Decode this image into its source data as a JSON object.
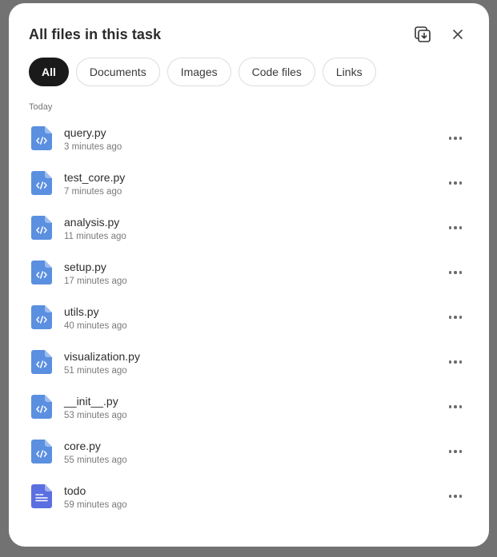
{
  "modal": {
    "title": "All files in this task"
  },
  "filters": [
    {
      "label": "All",
      "active": true
    },
    {
      "label": "Documents",
      "active": false
    },
    {
      "label": "Images",
      "active": false
    },
    {
      "label": "Code files",
      "active": false
    },
    {
      "label": "Links",
      "active": false
    }
  ],
  "section": {
    "label": "Today"
  },
  "files": [
    {
      "name": "query.py",
      "time": "3 minutes ago",
      "icon": "code-file-icon"
    },
    {
      "name": "test_core.py",
      "time": "7 minutes ago",
      "icon": "code-file-icon"
    },
    {
      "name": "analysis.py",
      "time": "11 minutes ago",
      "icon": "code-file-icon"
    },
    {
      "name": "setup.py",
      "time": "17 minutes ago",
      "icon": "code-file-icon"
    },
    {
      "name": "utils.py",
      "time": "40 minutes ago",
      "icon": "code-file-icon"
    },
    {
      "name": "visualization.py",
      "time": "51 minutes ago",
      "icon": "code-file-icon"
    },
    {
      "name": "__init__.py",
      "time": "53 minutes ago",
      "icon": "code-file-icon"
    },
    {
      "name": "core.py",
      "time": "55 minutes ago",
      "icon": "code-file-icon"
    },
    {
      "name": "todo",
      "time": "59 minutes ago",
      "icon": "document-file-icon"
    }
  ],
  "colors": {
    "code_icon": "#5b8fe0",
    "doc_icon": "#5b6fe0",
    "active_chip": "#1a1a1a"
  }
}
